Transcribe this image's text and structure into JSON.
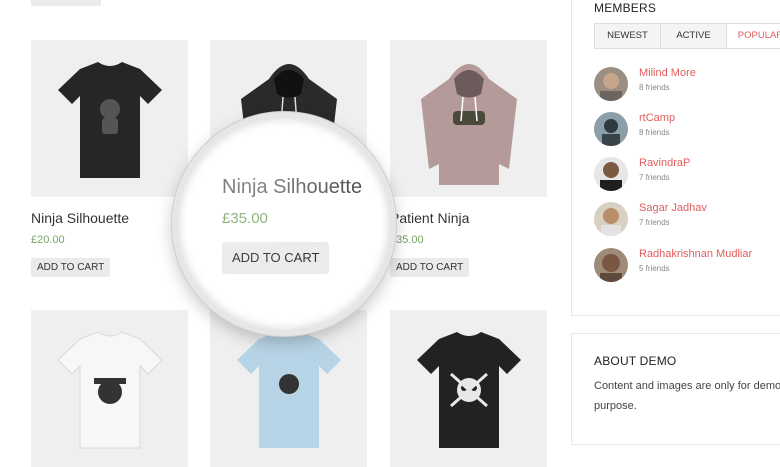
{
  "products": [
    {
      "title": "Ninja Silhouette",
      "price": "£20.00",
      "button": "ADD TO CART",
      "image": "black-tshirt-icon"
    },
    {
      "title": "",
      "price": "",
      "button": "",
      "image": "black-hoodie-icon"
    },
    {
      "title": "Patient Ninja",
      "price": "£35.00",
      "button": "ADD TO CART",
      "image": "pink-hoodie-icon"
    },
    {
      "title": "",
      "price": "",
      "button": "",
      "image": "white-tshirt-icon"
    },
    {
      "title": "",
      "price": "",
      "button": "",
      "image": "blue-tshirt-icon"
    },
    {
      "title": "",
      "price": "",
      "button": "",
      "image": "black-skull-tshirt-icon"
    }
  ],
  "magnifier": {
    "title": "Ninja Silhouette",
    "price": "£35.00",
    "button": "ADD TO CART"
  },
  "sidebar": {
    "members": {
      "title": "MEMBERS",
      "tabs": [
        "NEWEST",
        "ACTIVE",
        "POPULAR"
      ],
      "active_tab": "POPULAR",
      "list": [
        {
          "name": "Milind More",
          "friends": "8 friends"
        },
        {
          "name": "rtCamp",
          "friends": "8 friends"
        },
        {
          "name": "RavindraP",
          "friends": "7 friends"
        },
        {
          "name": "Sagar Jadhav",
          "friends": "7 friends"
        },
        {
          "name": "Radhakrishnan Mudliar",
          "friends": "5 friends"
        }
      ]
    },
    "about": {
      "title": "ABOUT DEMO",
      "line1": "Content and images are only for demo",
      "line2": "purpose."
    }
  },
  "colors": {
    "accent": "#e05d5d",
    "price": "#77a464",
    "button_bg": "#ebe9eb",
    "image_bg": "#efefef"
  }
}
